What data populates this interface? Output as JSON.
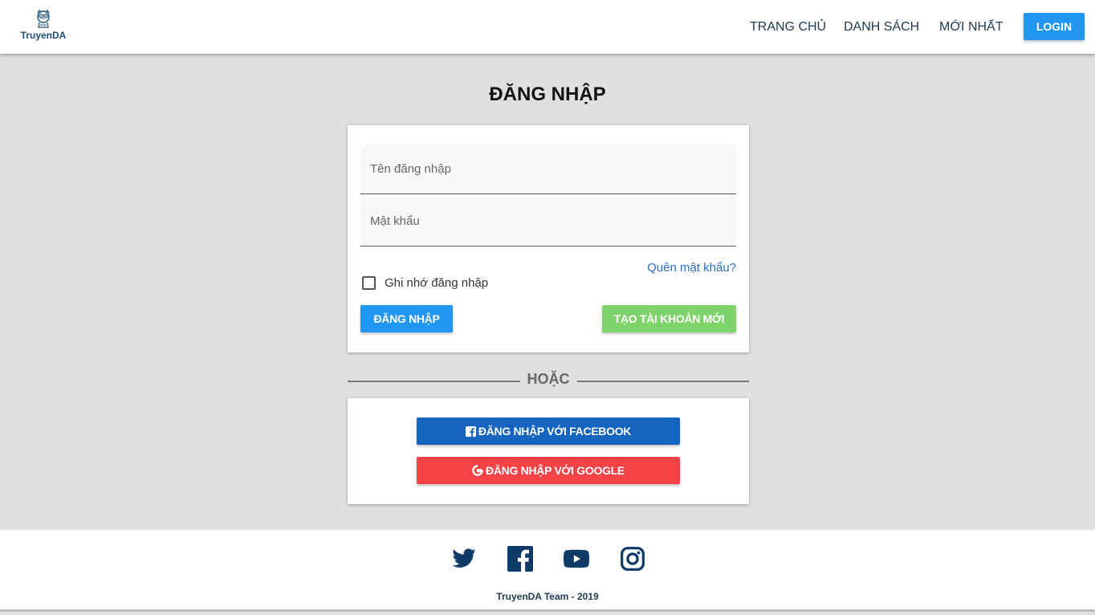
{
  "header": {
    "logo_text": "TruyenDA",
    "nav": [
      "TRANG CHỦ",
      "DANH SÁCH",
      "MỚI NHẤT"
    ],
    "login_label": "LOGIN"
  },
  "login": {
    "title": "ĐĂNG NHẬP",
    "username_placeholder": "Tên đăng nhập",
    "password_placeholder": "Mật khẩu",
    "forgot_label": "Quên mật khẩu?",
    "remember_label": "Ghi nhớ đăng nhập",
    "submit_label": "ĐĂNG NHẬP",
    "create_label": "TẠO TÀI KHOẢN MỚI"
  },
  "divider": {
    "text": "HOẶC"
  },
  "social": {
    "facebook_label": "ĐĂNG NHẬP VỚI FACEBOOK",
    "google_label": "ĐĂNG NHẬP VỚI GOOGLE"
  },
  "footer": {
    "icons": [
      "twitter-icon",
      "facebook-icon",
      "youtube-icon",
      "instagram-icon"
    ],
    "copyright": "TruyenDA Team - 2019"
  },
  "colors": {
    "primary": "#2196f3",
    "success": "#7ed46a",
    "facebook": "#1565c0",
    "google": "#f44347",
    "footer_icon": "#0d3a66",
    "background": "#e0e0e0"
  }
}
